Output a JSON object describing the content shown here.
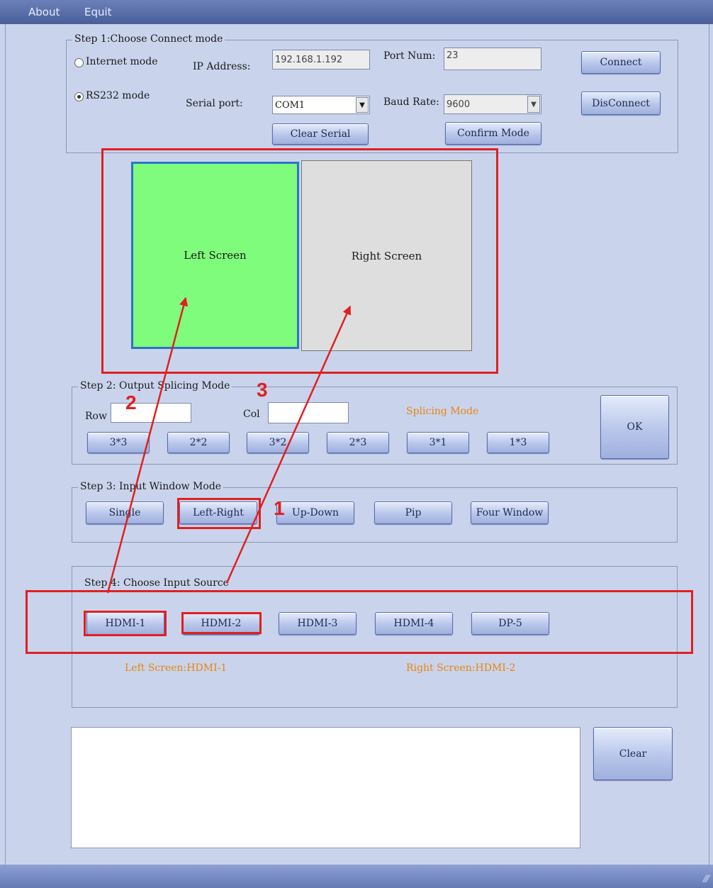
{
  "menu": {
    "about": "About",
    "equit": "Equit"
  },
  "step1": {
    "legend": "Step 1:Choose Connect mode",
    "internet_label": "Internet mode",
    "rs232_label": "RS232 mode",
    "selected_mode": "RS232 mode",
    "ip_label": "IP Address:",
    "ip_value": "192.168.1.192",
    "port_label": "Port Num:",
    "port_value": "23",
    "serial_label": "Serial port:",
    "serial_value": "COM1",
    "baud_label": "Baud Rate:",
    "baud_value": "9600",
    "clear_serial": "Clear Serial",
    "confirm_mode": "Confirm Mode",
    "connect": "Connect",
    "disconnect": "DisConnect"
  },
  "screens": {
    "left": {
      "label": "Left Screen",
      "color": "#80fc7c"
    },
    "right": {
      "label": "Right Screen",
      "color": "#dedede"
    }
  },
  "step2": {
    "legend": "Step 2: Output Splicing Mode",
    "row_label": "Row",
    "row_value": "",
    "col_label": "Col",
    "col_value": "",
    "splicing_label": "Splicing Mode",
    "modes": [
      "3*3",
      "2*2",
      "3*2",
      "2*3",
      "3*1",
      "1*3"
    ],
    "ok": "OK"
  },
  "step3": {
    "legend": "Step 3: Input Window Mode",
    "buttons": [
      "Single",
      "Left-Right",
      "Up-Down",
      "Pip",
      "Four Window"
    ]
  },
  "step4": {
    "legend": "Step 4: Choose  Input Source",
    "sources": [
      "HDMI-1",
      "HDMI-2",
      "HDMI-3",
      "HDMI-4",
      "DP-5"
    ],
    "left_status": "Left Screen:HDMI-1",
    "right_status": "Right Screen:HDMI-2"
  },
  "log": {
    "text": "",
    "clear": "Clear"
  },
  "annotations": {
    "n1": "1",
    "n2": "2",
    "n3": "3",
    "color": "#e02020"
  },
  "colors": {
    "background": "#c9d4ec",
    "accent_text": "#e8850e",
    "titlebar": "#4a5e9a"
  }
}
